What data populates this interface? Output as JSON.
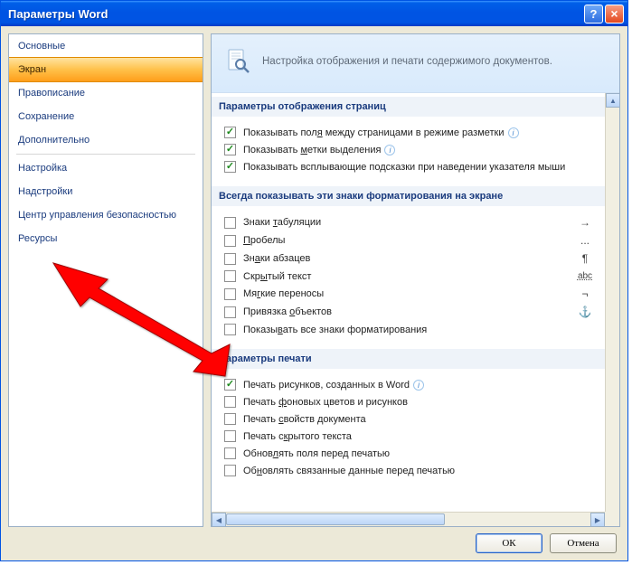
{
  "titlebar": {
    "title": "Параметры Word"
  },
  "sidebar": {
    "items": [
      {
        "label": "Основные"
      },
      {
        "label": "Экран",
        "active": true
      },
      {
        "label": "Правописание"
      },
      {
        "label": "Сохранение"
      },
      {
        "label": "Дополнительно"
      }
    ],
    "items2": [
      {
        "label": "Настройка"
      },
      {
        "label": "Надстройки"
      },
      {
        "label": "Центр управления безопасностью"
      },
      {
        "label": "Ресурсы"
      }
    ]
  },
  "header": {
    "text": "Настройка отображения и печати содержимого документов."
  },
  "sections": {
    "display": {
      "title": "Параметры отображения страниц",
      "opts": [
        {
          "label": "Показывать поля между страницами в режиме разметки",
          "u": "я",
          "checked": true,
          "info": true
        },
        {
          "label": "Показывать метки выделения",
          "u": "м",
          "checked": true,
          "info": true
        },
        {
          "label": "Показывать всплывающие подсказки при наведении указателя мыши",
          "u": "",
          "checked": true,
          "info": false
        }
      ]
    },
    "formatting": {
      "title": "Всегда показывать эти знаки форматирования на экране",
      "opts": [
        {
          "label": "Знаки табуляции",
          "u": "т",
          "checked": false,
          "sym": "→"
        },
        {
          "label": "Пробелы",
          "u": "П",
          "checked": false,
          "sym": "..."
        },
        {
          "label": "Знаки абзацев",
          "u": "а",
          "checked": false,
          "sym": "¶"
        },
        {
          "label": "Скрытый текст",
          "u": "ы",
          "checked": false,
          "sym": "abc"
        },
        {
          "label": "Мягкие переносы",
          "u": "г",
          "checked": false,
          "sym": "¬"
        },
        {
          "label": "Привязка объектов",
          "u": "о",
          "checked": false,
          "sym": "⚓"
        },
        {
          "label": "Показывать все знаки форматирования",
          "u": "в",
          "checked": false,
          "sym": ""
        }
      ]
    },
    "print": {
      "title": "Параметры печати",
      "opts": [
        {
          "label": "Печать рисунков, созданных в Word",
          "u": "",
          "checked": true,
          "info": true
        },
        {
          "label": "Печать фоновых цветов и рисунков",
          "u": "ф",
          "checked": false
        },
        {
          "label": "Печать свойств документа",
          "u": "с",
          "checked": false
        },
        {
          "label": "Печать скрытого текста",
          "u": "к",
          "checked": false
        },
        {
          "label": "Обновлять поля перед печатью",
          "u": "л",
          "checked": false
        },
        {
          "label": "Обновлять связанные данные перед печатью",
          "u": "н",
          "checked": false
        }
      ]
    }
  },
  "footer": {
    "ok": "ОК",
    "cancel": "Отмена"
  }
}
